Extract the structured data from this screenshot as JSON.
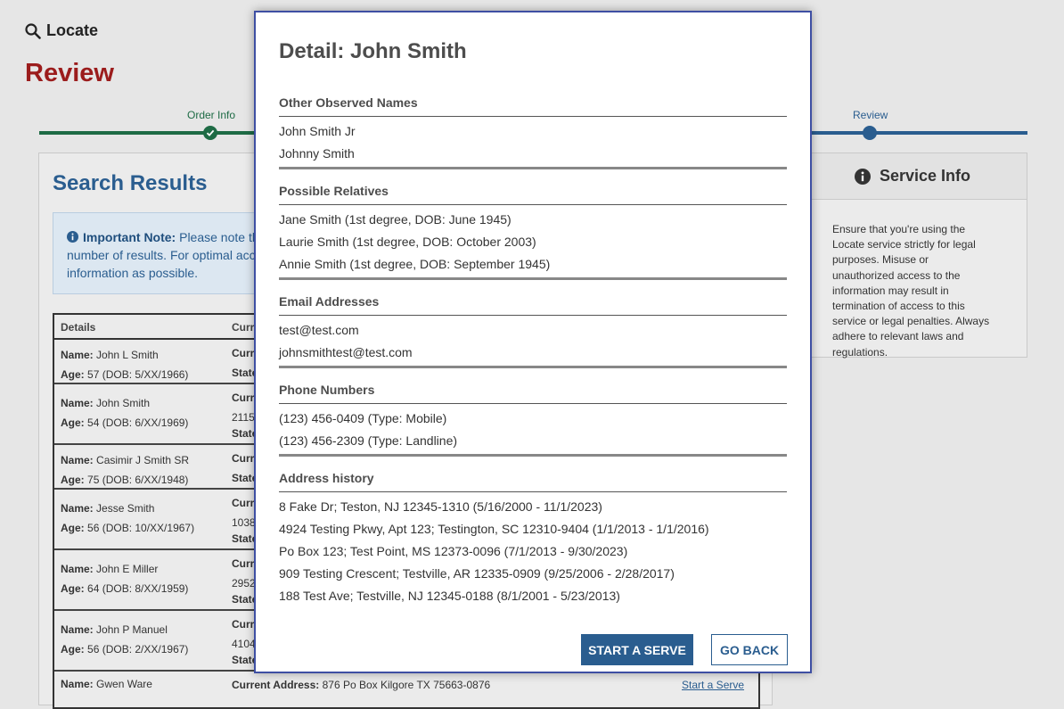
{
  "header": {
    "locate_label": "Locate",
    "page_title": "Review"
  },
  "steps": {
    "order_info": "Order Info",
    "review": "Review"
  },
  "results": {
    "title": "Search Results",
    "note_label": "Important Note:",
    "note_text_line1": "Please note th",
    "note_text_line2": "number of results. For optimal acc",
    "note_text_line3": "information as possible.",
    "col_details": "Details",
    "col_current": "Curr",
    "rows": [
      {
        "name": "John L Smith",
        "age": "57 (DOB: 5/XX/1966)",
        "c2a": "Curr",
        "c2b": "State"
      },
      {
        "name": "John Smith",
        "age": "54 (DOB: 6/XX/1969)",
        "c2a": "Curr",
        "c2b": "2115",
        "c2c": "State"
      },
      {
        "name": "Casimir J Smith SR",
        "age": "75 (DOB: 6/XX/1948)",
        "c2a": "Curr",
        "c2b": "State"
      },
      {
        "name": "Jesse Smith",
        "age": "56 (DOB: 10/XX/1967)",
        "c2a": "Curr",
        "c2b": "1038",
        "c2c": "State"
      },
      {
        "name": "John E Miller",
        "age": "64 (DOB: 8/XX/1959)",
        "c2a": "Curr",
        "c2b": "2952",
        "c2c": "State"
      },
      {
        "name": "John P Manuel",
        "age": "56 (DOB: 2/XX/1967)",
        "c2a": "Curr",
        "c2b": "4104",
        "c2c": "State"
      },
      {
        "name": "Gwen Ware",
        "current_address_label": "Current Address:",
        "current_address": "876 Po Box Kilgore TX 75663-0876",
        "start_serve_link": "Start a Serve"
      }
    ],
    "name_label": "Name:",
    "age_label": "Age:"
  },
  "service": {
    "title": "Service Info",
    "text": "Ensure that you're using the Locate service strictly for legal purposes. Misuse or unauthorized access to the information may result in termination of access to this service or legal penalties. Always adhere to relevant laws and regulations."
  },
  "modal": {
    "title": "Detail: John Smith",
    "sections": [
      {
        "title": "Other Observed Names",
        "items": [
          "John Smith Jr",
          "Johnny Smith"
        ]
      },
      {
        "title": "Possible Relatives",
        "items": [
          "Jane Smith (1st degree, DOB: June 1945)",
          "Laurie Smith (1st degree, DOB: October 2003)",
          "Annie Smith (1st degree, DOB: September 1945)"
        ]
      },
      {
        "title": "Email Addresses",
        "items": [
          "test@test.com",
          "johnsmithtest@test.com"
        ]
      },
      {
        "title": "Phone Numbers",
        "items": [
          "(123) 456-0409 (Type: Mobile)",
          "(123) 456-2309 (Type: Landline)"
        ]
      },
      {
        "title": "Address history",
        "items": [
          "8 Fake Dr; Teston, NJ 12345-1310 (5/16/2000 - 11/1/2023)",
          "4924 Testing Pkwy, Apt 123; Testington, SC 12310-9404 (1/1/2013 - 1/1/2016)",
          "Po Box 123; Test Point, MS 12373-0096 (7/1/2013 - 9/30/2023)",
          "909 Testing Crescent; Testville, AR 12335-0909 (9/25/2006 - 2/28/2017)",
          "188 Test Ave; Testville, NJ 12345-0188 (8/1/2001 - 5/23/2013)"
        ]
      }
    ],
    "start_serve": "START A SERVE",
    "go_back": "GO BACK"
  },
  "colors": {
    "brand_red": "#9b1c1c",
    "primary_blue": "#2a5d8f",
    "step_green": "#1e6b45",
    "modal_border": "#3e4fa3"
  }
}
